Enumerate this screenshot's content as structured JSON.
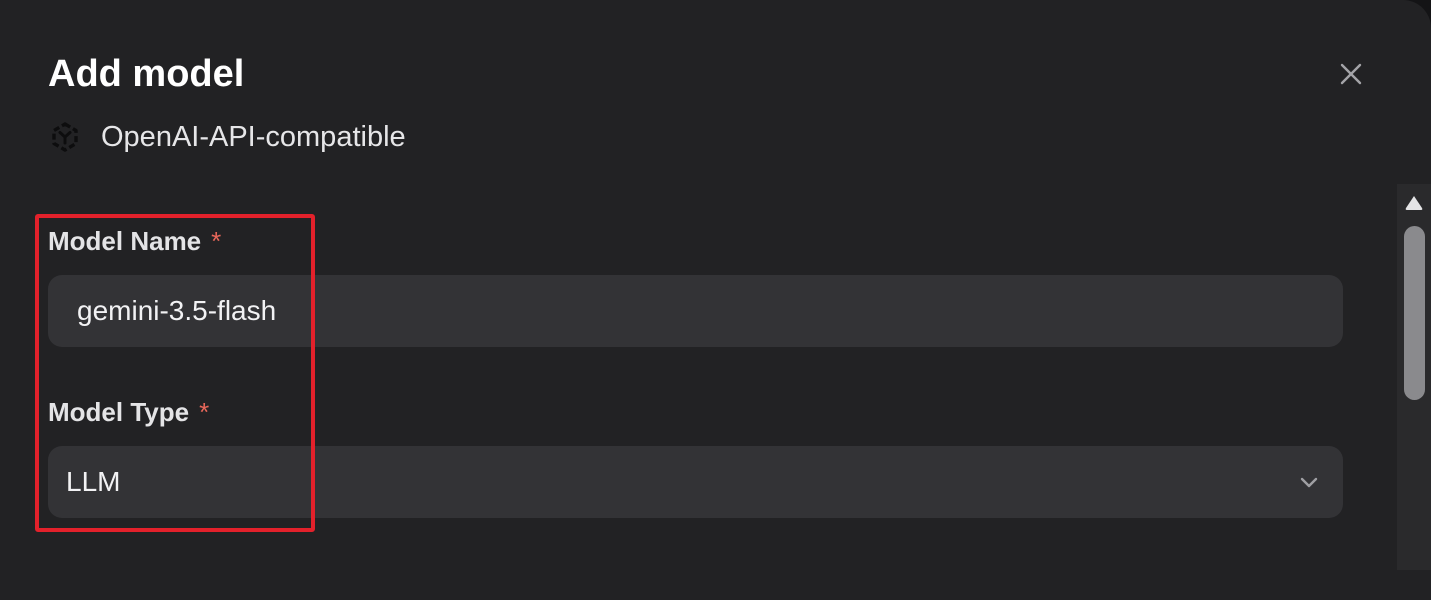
{
  "dialog": {
    "title": "Add model",
    "close_icon": "close-icon"
  },
  "provider": {
    "icon": "openai-compatible-icon",
    "label": "OpenAI-API-compatible"
  },
  "form": {
    "model_name": {
      "label": "Model Name",
      "required_mark": "*",
      "value": "gemini-3.5-flash"
    },
    "model_type": {
      "label": "Model Type",
      "required_mark": "*",
      "selected": "LLM",
      "dropdown_icon": "chevron-down-icon"
    }
  },
  "colors": {
    "dialog_bg": "#222224",
    "field_bg": "#333336",
    "required": "#e8675a",
    "highlight_box": "#e3212b"
  }
}
